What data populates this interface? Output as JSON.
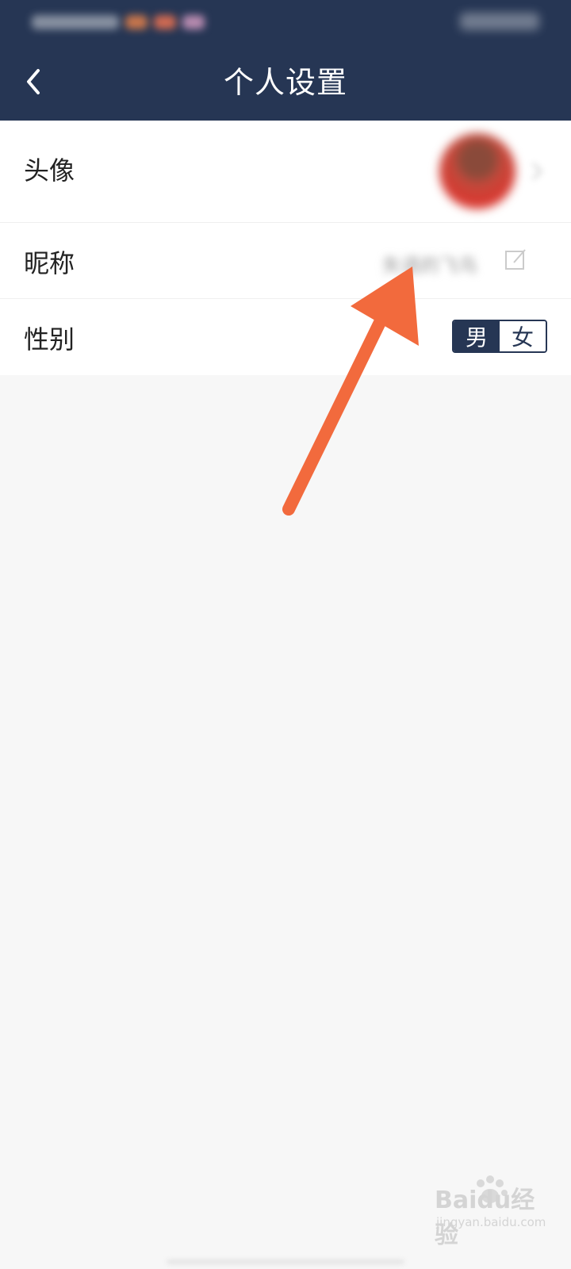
{
  "header": {
    "title": "个人设置"
  },
  "settings": {
    "avatar_label": "头像",
    "nickname_label": "昵称",
    "nickname_value": "失语的飞鸟",
    "gender_label": "性别",
    "gender_options": [
      "男",
      "女"
    ],
    "gender_selected": "男"
  },
  "watermark": {
    "logo_text": "Baidu经验",
    "sub_text": "jingyan.baidu.com"
  },
  "icons": {
    "back": "chevron-left-icon",
    "avatar_go": "chevron-right-icon",
    "edit": "edit-icon"
  },
  "colors": {
    "nav_background": "#263654",
    "page_background": "#f7f7f7",
    "row_background": "#ffffff",
    "annotation_arrow": "#f26a3d"
  }
}
